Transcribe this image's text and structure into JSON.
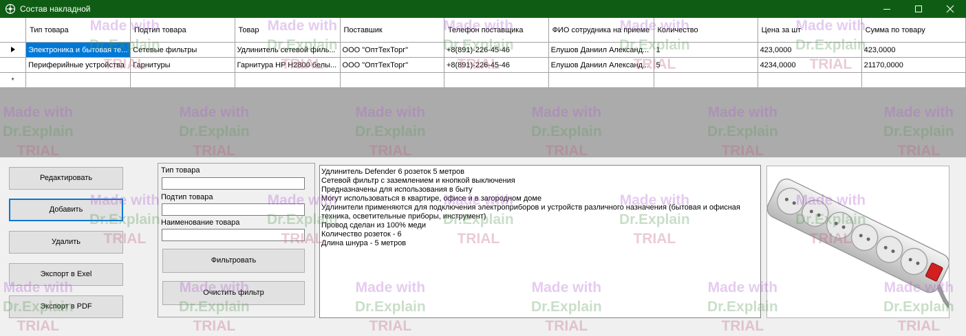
{
  "window": {
    "title": "Состав накладной"
  },
  "grid": {
    "headers": [
      "Тип товара",
      "Подтип товара",
      "Товар",
      "Поставшик",
      "Телефон поставщика",
      "ФИО сотрудника на приеме",
      "Количество",
      "Цена за шт",
      "Сумма по товару"
    ],
    "rows": [
      [
        "Электроника и бытовая те...",
        "Сетевые фильтры",
        "Удлинитель сетевой филь...",
        "ООО \"ОптТехТорг\"",
        "+8(891)-226-45-46",
        "Елушов Даниил Александ...",
        "1",
        "423,0000",
        "423,0000"
      ],
      [
        "Периферийные устройства",
        "Гарнитуры",
        "Гарнитура HP H2800 белы...",
        "ООО \"ОптТехТорг\"",
        "+8(891)-226-45-46",
        "Елушов Даниил Александ...",
        "5",
        "4234,0000",
        "21170,0000"
      ]
    ]
  },
  "buttons": {
    "edit": "Редактировать",
    "add": "Добавить",
    "delete": "Удалить",
    "export_excel": "Экспорт в Exel",
    "export_pdf": "Экспорт в PDF"
  },
  "filter": {
    "type_label": "Тип товара",
    "subtype_label": "Подтип товара",
    "name_label": "Наименование товара",
    "type_value": "",
    "subtype_value": "",
    "name_value": "",
    "filter_button": "Фильтровать",
    "clear_button": "Очистить фильтр"
  },
  "description": {
    "lines": [
      "Удлинитель Defender 6 розеток 5 метров",
      "Сетевой фильтр с заземлением и кнопкой выключения",
      "Предназначены для использования в быту",
      "Могут использоваться в квартире, офисе и в загородном доме",
      "Удлинители применяются для подключения электроприборов и устройств различного назначения (бытовая и офисная техника, осветительные приборы, инструмент)",
      "Провод сделан из 100% меди",
      "Количество розеток - 6",
      "Длина шнура - 5 метров"
    ]
  },
  "watermark": {
    "line1": "Made with",
    "line2": "Dr.Explain",
    "line3": "TRIAL"
  },
  "colors": {
    "titlebar": "#0f5d14",
    "selection": "#0078d7"
  }
}
